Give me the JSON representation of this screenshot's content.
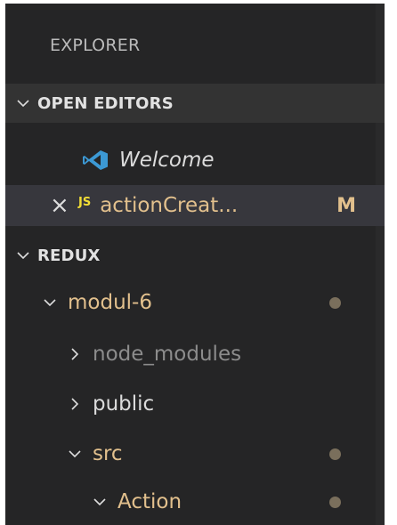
{
  "explorer": {
    "title": "EXPLORER"
  },
  "open_editors": {
    "header": "OPEN EDITORS",
    "items": [
      {
        "name": "Welcome",
        "icon": "vscode-icon"
      },
      {
        "name": "actionCreat...",
        "icon": "js-icon",
        "icon_text": "JS",
        "status": "M",
        "close": "×"
      }
    ]
  },
  "workspace": {
    "header": "REDUX",
    "tree": [
      {
        "name": "modul-6",
        "expanded": true
      },
      {
        "name": "node_modules",
        "expanded": false
      },
      {
        "name": "public",
        "expanded": false
      },
      {
        "name": "src",
        "expanded": true
      },
      {
        "name": "Action",
        "expanded": true
      }
    ]
  },
  "colors": {
    "background": "#252526",
    "selected_row": "#37373d",
    "section_header": "#333333",
    "modified": "#e2c08d",
    "folder_text": "#e2c08d",
    "ignored_text": "#8c8c8c",
    "js_icon": "#f1dd35",
    "vscode_icon": "#3c99d4"
  }
}
